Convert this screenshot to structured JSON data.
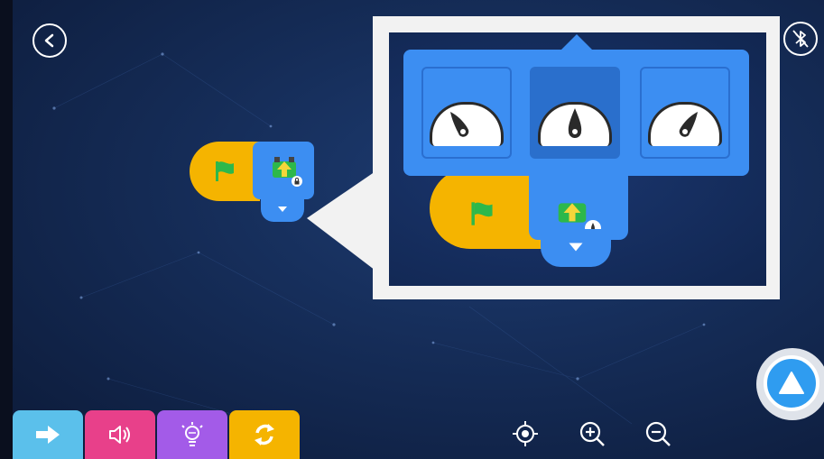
{
  "header": {
    "back_icon": "back-icon",
    "bluetooth_icon": "bluetooth-off-icon"
  },
  "canvas": {
    "flag_icon": "green-flag-icon",
    "motion_icon": "move-forward-icon",
    "lock_icon": "lock-icon",
    "dropdown_icon": "chevron-down-icon"
  },
  "callout": {
    "speed_options": [
      {
        "icon": "speed-slow-icon",
        "selected": false
      },
      {
        "icon": "speed-medium-icon",
        "selected": true
      },
      {
        "icon": "speed-fast-icon",
        "selected": false
      }
    ]
  },
  "toolbar": {
    "categories": [
      {
        "icon": "arrow-right-icon",
        "color": "#5bc0eb"
      },
      {
        "icon": "speaker-icon",
        "color": "#e8408a"
      },
      {
        "icon": "lightbulb-icon",
        "color": "#a35be8"
      },
      {
        "icon": "loop-icon",
        "color": "#f5b400"
      }
    ],
    "controls": [
      "recenter-icon",
      "zoom-in-icon",
      "zoom-out-icon"
    ]
  },
  "run_button": {
    "icon": "play-icon",
    "color": "#2f9cf0"
  },
  "colors": {
    "background": "#152c57",
    "block_blue": "#3c8ef2",
    "block_yellow": "#f5b400",
    "flag_green": "#2db84b"
  }
}
